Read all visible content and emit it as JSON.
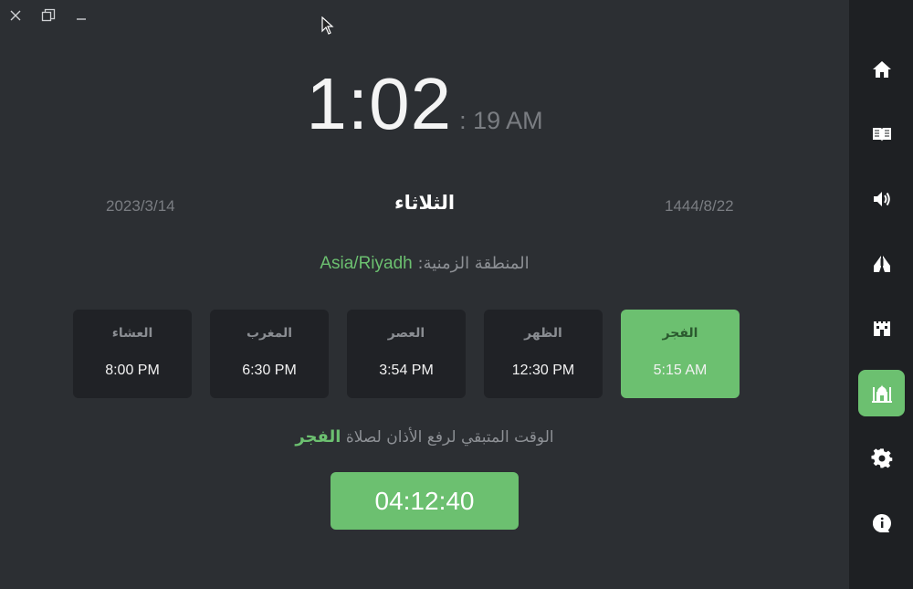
{
  "clock": {
    "hours_minutes": "1:02",
    "seconds_ampm": ": 19 AM"
  },
  "date": {
    "gregorian": "2023/3/14",
    "day_name": "الثلاثاء",
    "hijri": "1444/8/22"
  },
  "timezone": {
    "label": "المنطقة الزمنية:",
    "value": "Asia/Riyadh"
  },
  "prayers": [
    {
      "name": "العشاء",
      "time": "8:00 PM"
    },
    {
      "name": "المغرب",
      "time": "6:30 PM"
    },
    {
      "name": "العصر",
      "time": "3:54 PM"
    },
    {
      "name": "الظهر",
      "time": "12:30 PM"
    },
    {
      "name": "الفجر",
      "time": "5:15 AM"
    }
  ],
  "next_prayer": {
    "label": "الوقت المتبقي لرفع الأذان لصلاة",
    "prayer": "الفجر",
    "countdown": "04:12:40"
  },
  "sidebar": {
    "items": [
      {
        "icon": "home-icon"
      },
      {
        "icon": "book-icon"
      },
      {
        "icon": "volume-icon"
      },
      {
        "icon": "praying-hands-icon"
      },
      {
        "icon": "fort-icon"
      },
      {
        "icon": "mosque-icon",
        "active": true
      },
      {
        "icon": "gear-icon"
      },
      {
        "icon": "info-icon"
      }
    ]
  },
  "colors": {
    "background": "#2c2f33",
    "sidebar": "#1e2023",
    "card": "#202226",
    "accent": "#6cc070"
  }
}
